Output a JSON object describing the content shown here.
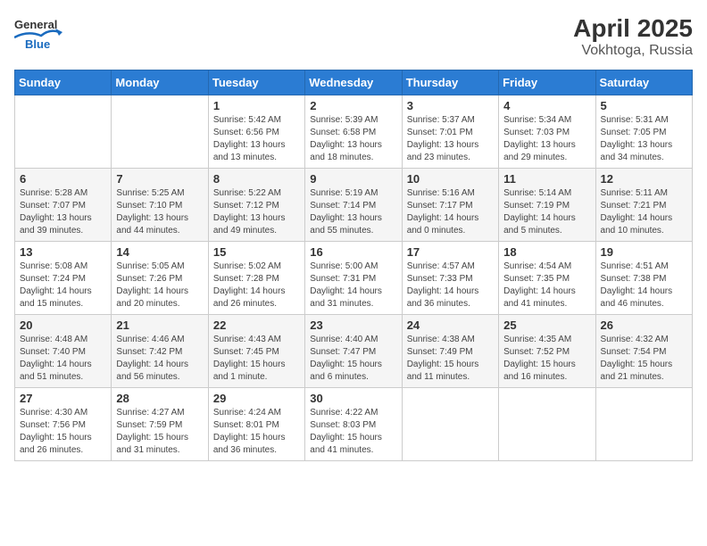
{
  "header": {
    "logo_general": "General",
    "logo_blue": "Blue",
    "title": "April 2025",
    "subtitle": "Vokhtoga, Russia"
  },
  "days_of_week": [
    "Sunday",
    "Monday",
    "Tuesday",
    "Wednesday",
    "Thursday",
    "Friday",
    "Saturday"
  ],
  "weeks": [
    {
      "shaded": false,
      "days": [
        {
          "number": "",
          "sunrise": "",
          "sunset": "",
          "daylight": ""
        },
        {
          "number": "",
          "sunrise": "",
          "sunset": "",
          "daylight": ""
        },
        {
          "number": "1",
          "sunrise": "Sunrise: 5:42 AM",
          "sunset": "Sunset: 6:56 PM",
          "daylight": "Daylight: 13 hours and 13 minutes."
        },
        {
          "number": "2",
          "sunrise": "Sunrise: 5:39 AM",
          "sunset": "Sunset: 6:58 PM",
          "daylight": "Daylight: 13 hours and 18 minutes."
        },
        {
          "number": "3",
          "sunrise": "Sunrise: 5:37 AM",
          "sunset": "Sunset: 7:01 PM",
          "daylight": "Daylight: 13 hours and 23 minutes."
        },
        {
          "number": "4",
          "sunrise": "Sunrise: 5:34 AM",
          "sunset": "Sunset: 7:03 PM",
          "daylight": "Daylight: 13 hours and 29 minutes."
        },
        {
          "number": "5",
          "sunrise": "Sunrise: 5:31 AM",
          "sunset": "Sunset: 7:05 PM",
          "daylight": "Daylight: 13 hours and 34 minutes."
        }
      ]
    },
    {
      "shaded": true,
      "days": [
        {
          "number": "6",
          "sunrise": "Sunrise: 5:28 AM",
          "sunset": "Sunset: 7:07 PM",
          "daylight": "Daylight: 13 hours and 39 minutes."
        },
        {
          "number": "7",
          "sunrise": "Sunrise: 5:25 AM",
          "sunset": "Sunset: 7:10 PM",
          "daylight": "Daylight: 13 hours and 44 minutes."
        },
        {
          "number": "8",
          "sunrise": "Sunrise: 5:22 AM",
          "sunset": "Sunset: 7:12 PM",
          "daylight": "Daylight: 13 hours and 49 minutes."
        },
        {
          "number": "9",
          "sunrise": "Sunrise: 5:19 AM",
          "sunset": "Sunset: 7:14 PM",
          "daylight": "Daylight: 13 hours and 55 minutes."
        },
        {
          "number": "10",
          "sunrise": "Sunrise: 5:16 AM",
          "sunset": "Sunset: 7:17 PM",
          "daylight": "Daylight: 14 hours and 0 minutes."
        },
        {
          "number": "11",
          "sunrise": "Sunrise: 5:14 AM",
          "sunset": "Sunset: 7:19 PM",
          "daylight": "Daylight: 14 hours and 5 minutes."
        },
        {
          "number": "12",
          "sunrise": "Sunrise: 5:11 AM",
          "sunset": "Sunset: 7:21 PM",
          "daylight": "Daylight: 14 hours and 10 minutes."
        }
      ]
    },
    {
      "shaded": false,
      "days": [
        {
          "number": "13",
          "sunrise": "Sunrise: 5:08 AM",
          "sunset": "Sunset: 7:24 PM",
          "daylight": "Daylight: 14 hours and 15 minutes."
        },
        {
          "number": "14",
          "sunrise": "Sunrise: 5:05 AM",
          "sunset": "Sunset: 7:26 PM",
          "daylight": "Daylight: 14 hours and 20 minutes."
        },
        {
          "number": "15",
          "sunrise": "Sunrise: 5:02 AM",
          "sunset": "Sunset: 7:28 PM",
          "daylight": "Daylight: 14 hours and 26 minutes."
        },
        {
          "number": "16",
          "sunrise": "Sunrise: 5:00 AM",
          "sunset": "Sunset: 7:31 PM",
          "daylight": "Daylight: 14 hours and 31 minutes."
        },
        {
          "number": "17",
          "sunrise": "Sunrise: 4:57 AM",
          "sunset": "Sunset: 7:33 PM",
          "daylight": "Daylight: 14 hours and 36 minutes."
        },
        {
          "number": "18",
          "sunrise": "Sunrise: 4:54 AM",
          "sunset": "Sunset: 7:35 PM",
          "daylight": "Daylight: 14 hours and 41 minutes."
        },
        {
          "number": "19",
          "sunrise": "Sunrise: 4:51 AM",
          "sunset": "Sunset: 7:38 PM",
          "daylight": "Daylight: 14 hours and 46 minutes."
        }
      ]
    },
    {
      "shaded": true,
      "days": [
        {
          "number": "20",
          "sunrise": "Sunrise: 4:48 AM",
          "sunset": "Sunset: 7:40 PM",
          "daylight": "Daylight: 14 hours and 51 minutes."
        },
        {
          "number": "21",
          "sunrise": "Sunrise: 4:46 AM",
          "sunset": "Sunset: 7:42 PM",
          "daylight": "Daylight: 14 hours and 56 minutes."
        },
        {
          "number": "22",
          "sunrise": "Sunrise: 4:43 AM",
          "sunset": "Sunset: 7:45 PM",
          "daylight": "Daylight: 15 hours and 1 minute."
        },
        {
          "number": "23",
          "sunrise": "Sunrise: 4:40 AM",
          "sunset": "Sunset: 7:47 PM",
          "daylight": "Daylight: 15 hours and 6 minutes."
        },
        {
          "number": "24",
          "sunrise": "Sunrise: 4:38 AM",
          "sunset": "Sunset: 7:49 PM",
          "daylight": "Daylight: 15 hours and 11 minutes."
        },
        {
          "number": "25",
          "sunrise": "Sunrise: 4:35 AM",
          "sunset": "Sunset: 7:52 PM",
          "daylight": "Daylight: 15 hours and 16 minutes."
        },
        {
          "number": "26",
          "sunrise": "Sunrise: 4:32 AM",
          "sunset": "Sunset: 7:54 PM",
          "daylight": "Daylight: 15 hours and 21 minutes."
        }
      ]
    },
    {
      "shaded": false,
      "days": [
        {
          "number": "27",
          "sunrise": "Sunrise: 4:30 AM",
          "sunset": "Sunset: 7:56 PM",
          "daylight": "Daylight: 15 hours and 26 minutes."
        },
        {
          "number": "28",
          "sunrise": "Sunrise: 4:27 AM",
          "sunset": "Sunset: 7:59 PM",
          "daylight": "Daylight: 15 hours and 31 minutes."
        },
        {
          "number": "29",
          "sunrise": "Sunrise: 4:24 AM",
          "sunset": "Sunset: 8:01 PM",
          "daylight": "Daylight: 15 hours and 36 minutes."
        },
        {
          "number": "30",
          "sunrise": "Sunrise: 4:22 AM",
          "sunset": "Sunset: 8:03 PM",
          "daylight": "Daylight: 15 hours and 41 minutes."
        },
        {
          "number": "",
          "sunrise": "",
          "sunset": "",
          "daylight": ""
        },
        {
          "number": "",
          "sunrise": "",
          "sunset": "",
          "daylight": ""
        },
        {
          "number": "",
          "sunrise": "",
          "sunset": "",
          "daylight": ""
        }
      ]
    }
  ]
}
